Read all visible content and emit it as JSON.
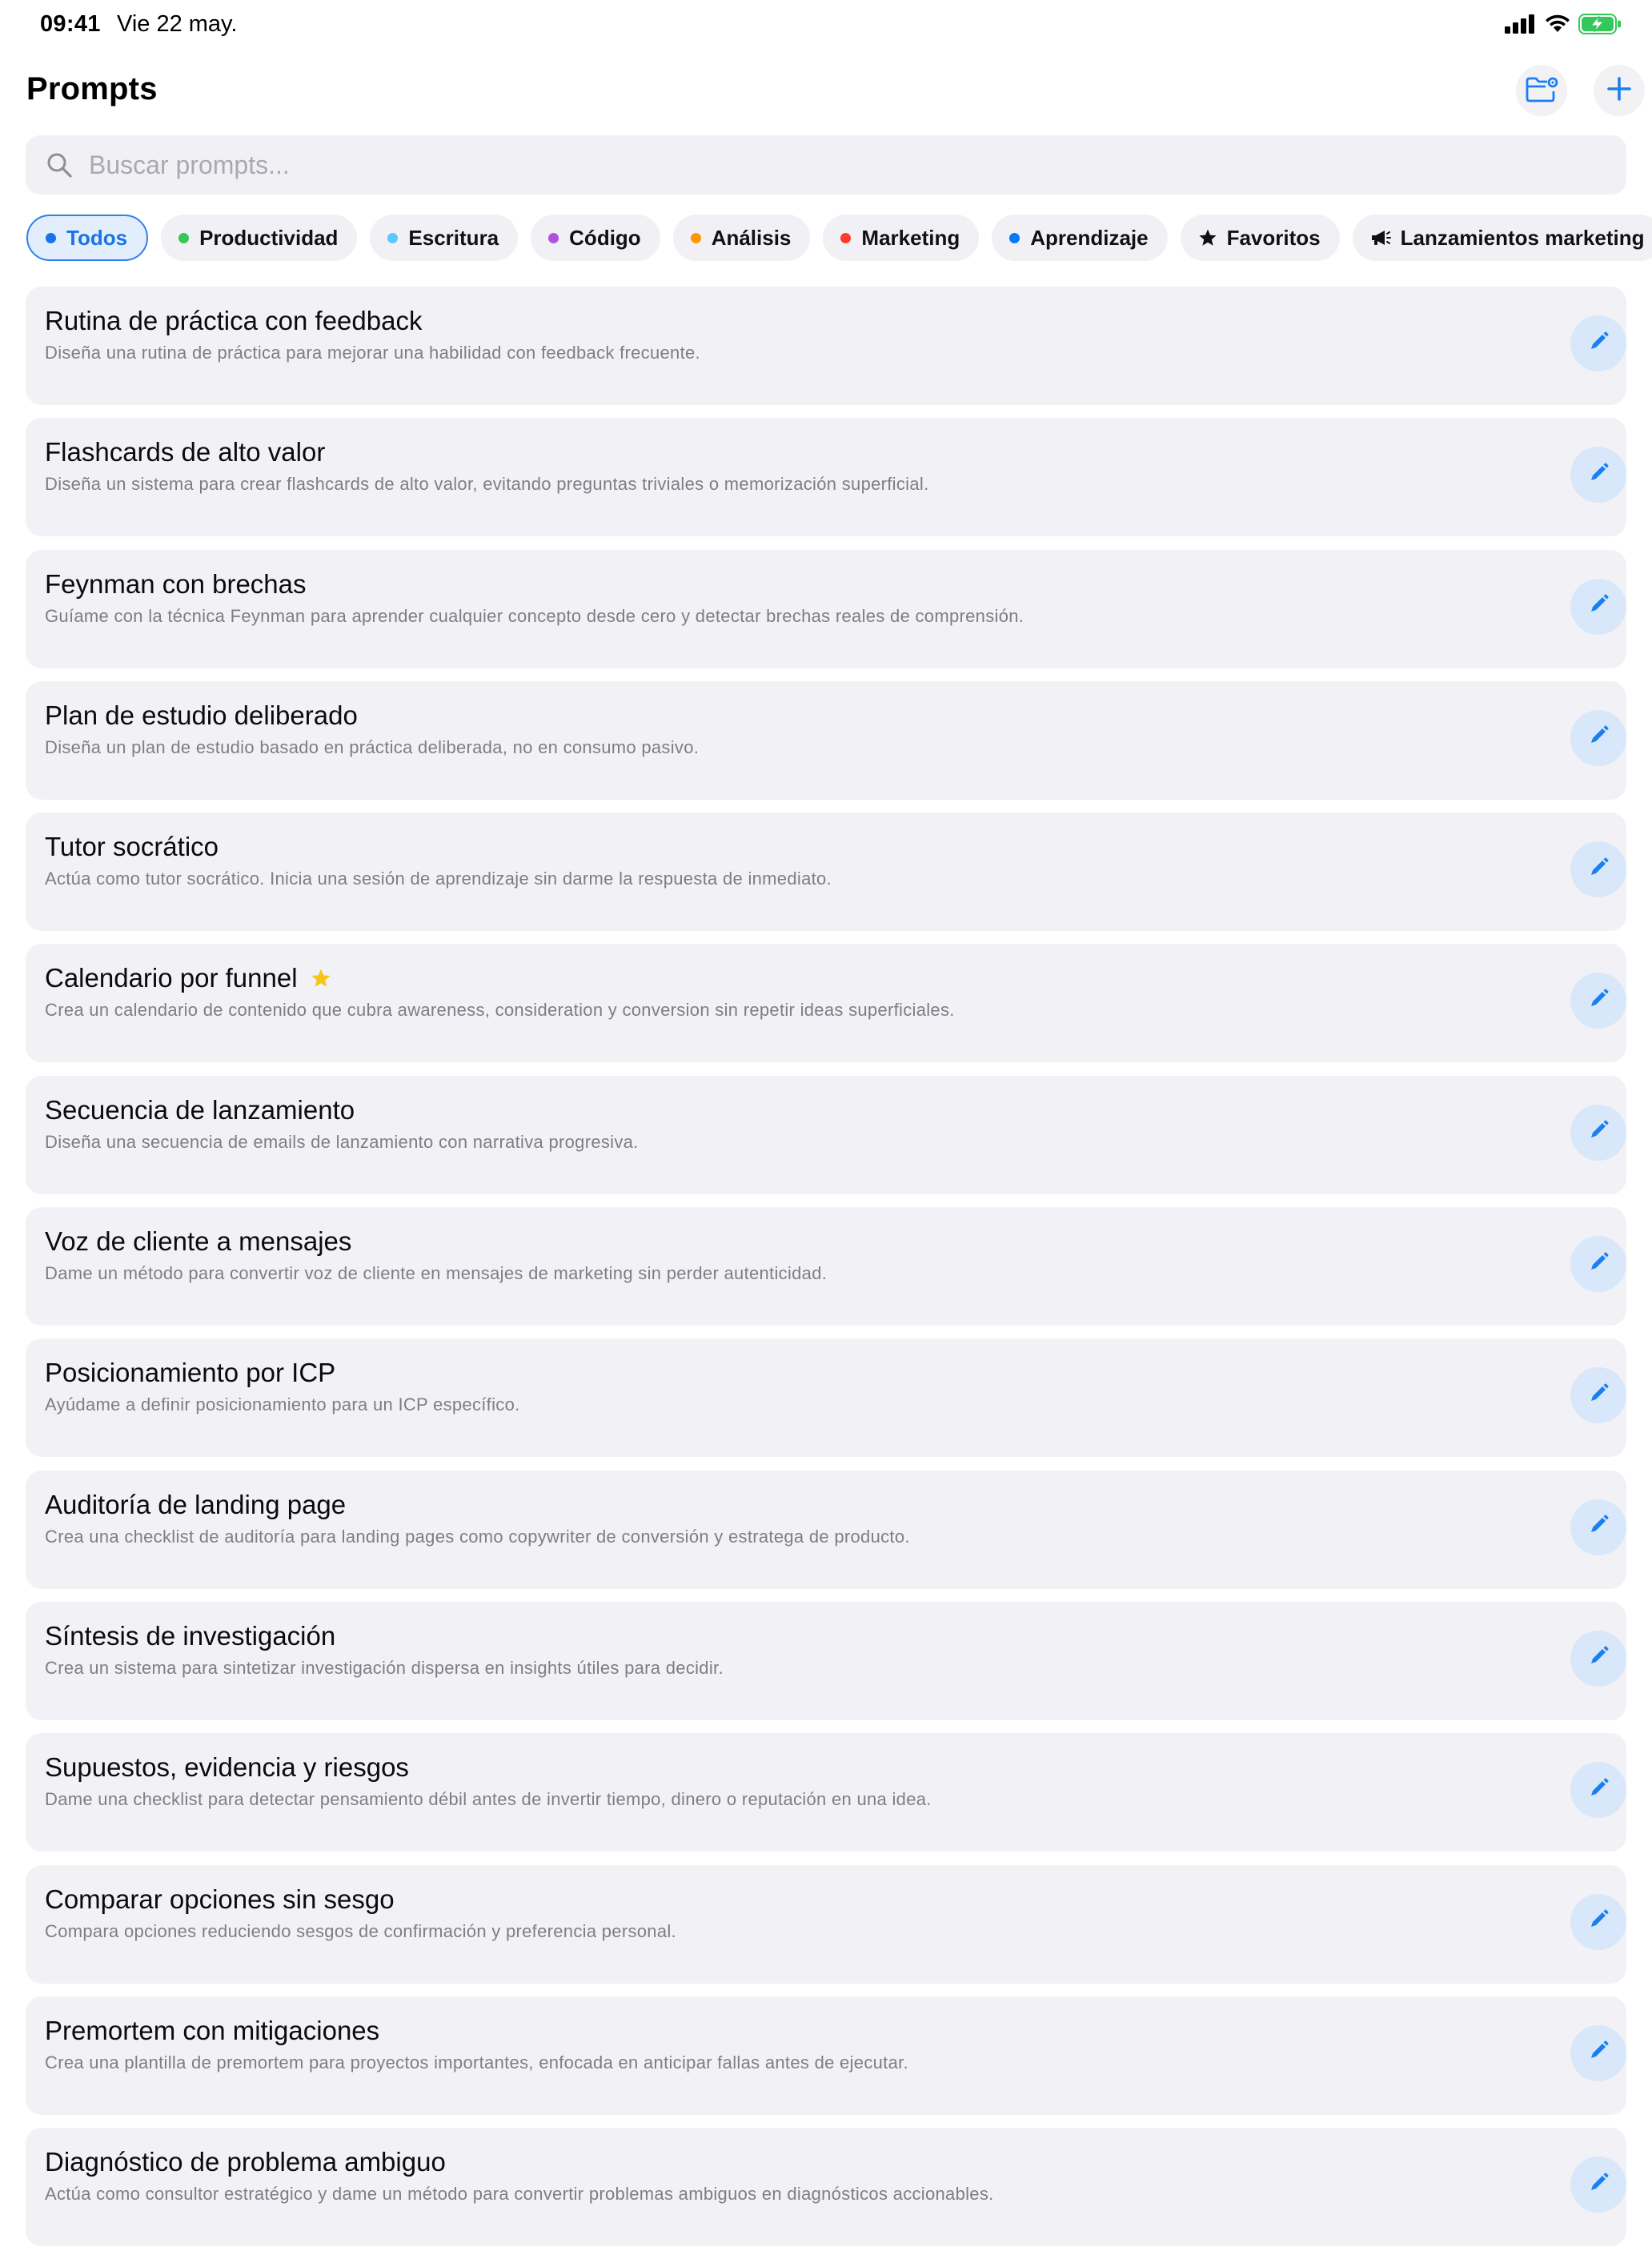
{
  "status_bar": {
    "time": "09:41",
    "date": "Vie 22 may."
  },
  "header": {
    "title": "Prompts",
    "folder_button_icon": "folder-settings-icon",
    "add_button_icon": "plus-icon"
  },
  "search": {
    "placeholder": "Buscar prompts...",
    "value": ""
  },
  "filters": [
    {
      "label": "Todos",
      "color": "#1a73e8",
      "active": true
    },
    {
      "label": "Productividad",
      "color": "#34c759"
    },
    {
      "label": "Escritura",
      "color": "#5ac8fa"
    },
    {
      "label": "Código",
      "color": "#af52de"
    },
    {
      "label": "Análisis",
      "color": "#ff9500"
    },
    {
      "label": "Marketing",
      "color": "#ff3b30"
    },
    {
      "label": "Aprendizaje",
      "color": "#007aff"
    },
    {
      "label": "Favoritos",
      "icon": "star-icon"
    },
    {
      "label": "Lanzamientos marketing",
      "icon": "megaphone-icon"
    }
  ],
  "prompts": [
    {
      "title": "Rutina de práctica con feedback",
      "description": "Diseña una rutina de práctica para mejorar una habilidad con feedback frecuente."
    },
    {
      "title": "Flashcards de alto valor",
      "description": "Diseña un sistema para crear flashcards de alto valor, evitando preguntas triviales o memorización superficial."
    },
    {
      "title": "Feynman con brechas",
      "description": "Guíame con la técnica Feynman para aprender cualquier concepto desde cero y detectar brechas reales de comprensión."
    },
    {
      "title": "Plan de estudio deliberado",
      "description": "Diseña un plan de estudio basado en práctica deliberada, no en consumo pasivo."
    },
    {
      "title": "Tutor socrático",
      "description": "Actúa como tutor socrático. Inicia una sesión de aprendizaje sin darme la respuesta de inmediato."
    },
    {
      "title": "Calendario por funnel",
      "description": "Crea un calendario de contenido que cubra awareness, consideration y conversion sin repetir ideas superficiales.",
      "favorite": true
    },
    {
      "title": "Secuencia de lanzamiento",
      "description": "Diseña una secuencia de emails de lanzamiento con narrativa progresiva."
    },
    {
      "title": "Voz de cliente a mensajes",
      "description": "Dame un método para convertir voz de cliente en mensajes de marketing sin perder autenticidad."
    },
    {
      "title": "Posicionamiento por ICP",
      "description": "Ayúdame a definir posicionamiento para un ICP específico."
    },
    {
      "title": "Auditoría de landing page",
      "description": "Crea una checklist de auditoría para landing pages como copywriter de conversión y estratega de producto."
    },
    {
      "title": "Síntesis de investigación",
      "description": "Crea un sistema para sintetizar investigación dispersa en insights útiles para decidir."
    },
    {
      "title": "Supuestos, evidencia y riesgos",
      "description": "Dame una checklist para detectar pensamiento débil antes de invertir tiempo, dinero o reputación en una idea."
    },
    {
      "title": "Comparar opciones sin sesgo",
      "description": "Compara opciones reduciendo sesgos de confirmación y preferencia personal."
    },
    {
      "title": "Premortem con mitigaciones",
      "description": "Crea una plantilla de premortem para proyectos importantes, enfocada en anticipar fallas antes de ejecutar."
    },
    {
      "title": "Diagnóstico de problema ambiguo",
      "description": "Actúa como consultor estratégico y dame un método para convertir problemas ambiguos en diagnósticos accionables."
    }
  ],
  "colors": {
    "accent": "#1a73e8",
    "favorite_star": "#f5c518",
    "card_background": "#f2f2f6"
  }
}
